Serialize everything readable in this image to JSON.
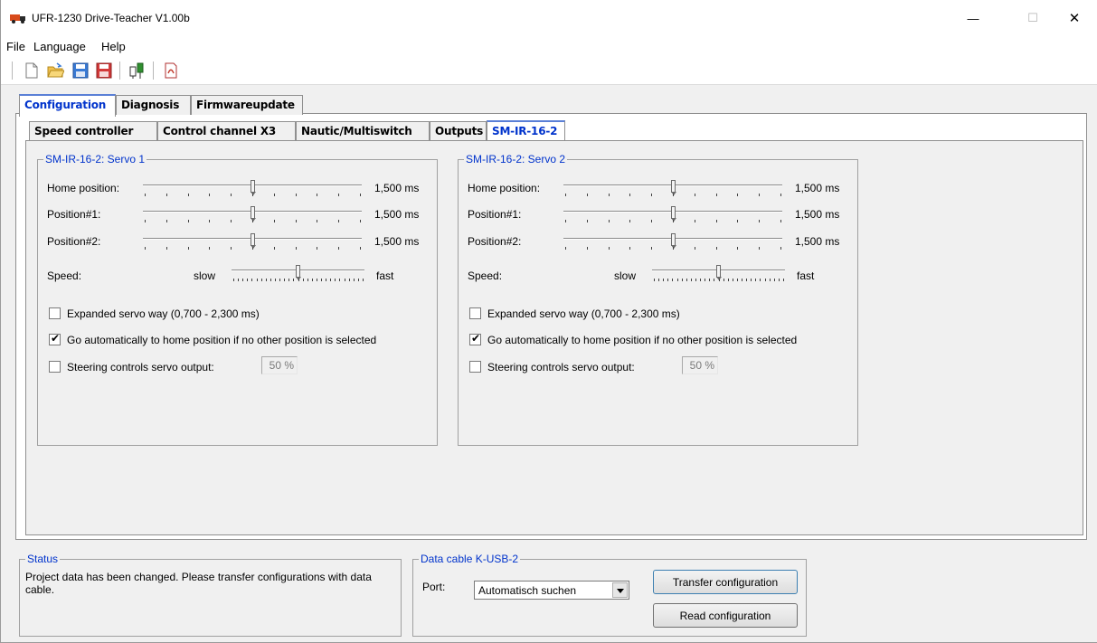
{
  "window": {
    "title": "UFR-1230 Drive-Teacher V1.00b",
    "minimize": "—",
    "maximize": "☐",
    "close": "✕"
  },
  "menu": {
    "file": "File",
    "language": "Language",
    "help": "Help"
  },
  "toolbar": {
    "icons": [
      "new-file-icon",
      "open-folder-icon",
      "save-icon",
      "save-as-icon",
      "connection-icon",
      "pdf-icon"
    ]
  },
  "outer_tabs": [
    {
      "label": "Configuration",
      "active": true
    },
    {
      "label": "Diagnosis",
      "active": false
    },
    {
      "label": "Firmwareupdate",
      "active": false
    }
  ],
  "inner_tabs": [
    {
      "label": "Speed controller",
      "active": false
    },
    {
      "label": "Control channel X3",
      "active": false
    },
    {
      "label": "Nautic/Multiswitch",
      "active": false
    },
    {
      "label": "Outputs",
      "active": false
    },
    {
      "label": "SM-IR-16-2",
      "active": true
    }
  ],
  "servos": [
    {
      "title": "SM-IR-16-2: Servo 1",
      "home_label": "Home position:",
      "home_value": "1,500 ms",
      "home_level": 0.5,
      "pos1_label": "Position#1:",
      "pos1_value": "1,500 ms",
      "pos1_level": 0.5,
      "pos2_label": "Position#2:",
      "pos2_value": "1,500 ms",
      "pos2_level": 0.5,
      "speed_label": "Speed:",
      "speed_slow": "slow",
      "speed_fast": "fast",
      "speed_level": 0.5,
      "expanded_label": "Expanded servo way (0,700 - 2,300 ms)",
      "expanded_checked": false,
      "auto_home_label": "Go automatically to home position if no other position is selected",
      "auto_home_checked": true,
      "steering_label": "Steering controls servo output:",
      "steering_checked": false,
      "steering_value": "50 %"
    },
    {
      "title": "SM-IR-16-2: Servo 2",
      "home_label": "Home position:",
      "home_value": "1,500 ms",
      "home_level": 0.5,
      "pos1_label": "Position#1:",
      "pos1_value": "1,500 ms",
      "pos1_level": 0.5,
      "pos2_label": "Position#2:",
      "pos2_value": "1,500 ms",
      "pos2_level": 0.5,
      "speed_label": "Speed:",
      "speed_slow": "slow",
      "speed_fast": "fast",
      "speed_level": 0.5,
      "expanded_label": "Expanded servo way (0,700 - 2,300 ms)",
      "expanded_checked": false,
      "auto_home_label": "Go automatically to home position if no other position is selected",
      "auto_home_checked": true,
      "steering_label": "Steering controls servo output:",
      "steering_checked": false,
      "steering_value": "50 %"
    }
  ],
  "status": {
    "title": "Status",
    "message": "Project data has been changed. Please transfer configurations with data cable."
  },
  "data_cable": {
    "title": "Data cable K-USB-2",
    "port_label": "Port:",
    "port_value": "Automatisch suchen",
    "transfer_button": "Transfer configuration",
    "read_button": "Read configuration"
  }
}
